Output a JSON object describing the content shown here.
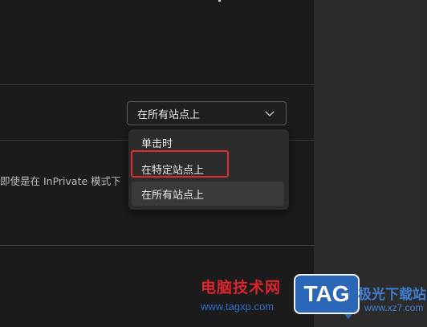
{
  "setting": {
    "selected_value": "在所有站点上",
    "description": "即使是在 InPrivate 模式下"
  },
  "dropdown": {
    "options": [
      {
        "label": "单击时"
      },
      {
        "label": "在特定站点上"
      },
      {
        "label": "在所有站点上"
      }
    ],
    "selected_index": 2,
    "highlighted_index": 1
  },
  "watermark": {
    "title": "电脑技术网",
    "url": "www.tagxp.com",
    "badge": "TAG",
    "site_name": "极光下载站",
    "site_url": "www.xz7.com"
  },
  "colors": {
    "highlight_border": "#e02b2b",
    "panel_bg": "#1b1b1b",
    "dropdown_bg": "#2c2c2c"
  }
}
